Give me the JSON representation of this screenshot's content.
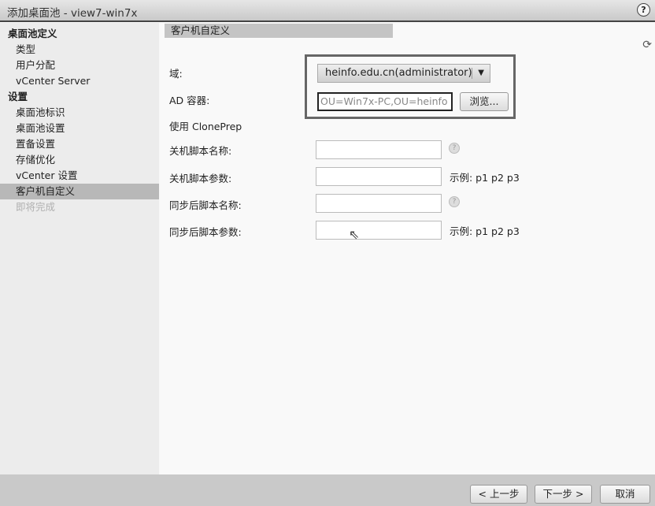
{
  "window": {
    "title": "添加桌面池 - view7-win7x",
    "help_icon": "?"
  },
  "sidebar": {
    "items": [
      {
        "label": "桌面池定义",
        "type": "header"
      },
      {
        "label": "类型",
        "type": "item"
      },
      {
        "label": "用户分配",
        "type": "item"
      },
      {
        "label": "vCenter Server",
        "type": "item"
      },
      {
        "label": "设置",
        "type": "header"
      },
      {
        "label": "桌面池标识",
        "type": "item"
      },
      {
        "label": "桌面池设置",
        "type": "item"
      },
      {
        "label": "置备设置",
        "type": "item"
      },
      {
        "label": "存储优化",
        "type": "item"
      },
      {
        "label": "vCenter 设置",
        "type": "item"
      },
      {
        "label": "客户机自定义",
        "type": "selected"
      },
      {
        "label": "即将完成",
        "type": "disabled"
      }
    ]
  },
  "main": {
    "section_title": "客户机自定义",
    "domain_label": "域:",
    "domain_value": "heinfo.edu.cn(administrator)",
    "ad_label": "AD 容器:",
    "ad_value": "OU=Win7x-PC,OU=heinfo",
    "browse_label": "浏览...",
    "cloneprep_label": "使用 ClonePrep",
    "fields": [
      {
        "label": "关机脚本名称:",
        "value": "",
        "hint": "?"
      },
      {
        "label": "关机脚本参数:",
        "value": "",
        "hint": "示例: p1 p2 p3"
      },
      {
        "label": "同步后脚本名称:",
        "value": "",
        "hint": "?"
      },
      {
        "label": "同步后脚本参数:",
        "value": "",
        "hint": "示例: p1 p2 p3"
      }
    ]
  },
  "footer": {
    "back": "< 上一步",
    "next": "下一步 >",
    "cancel": "取消"
  }
}
